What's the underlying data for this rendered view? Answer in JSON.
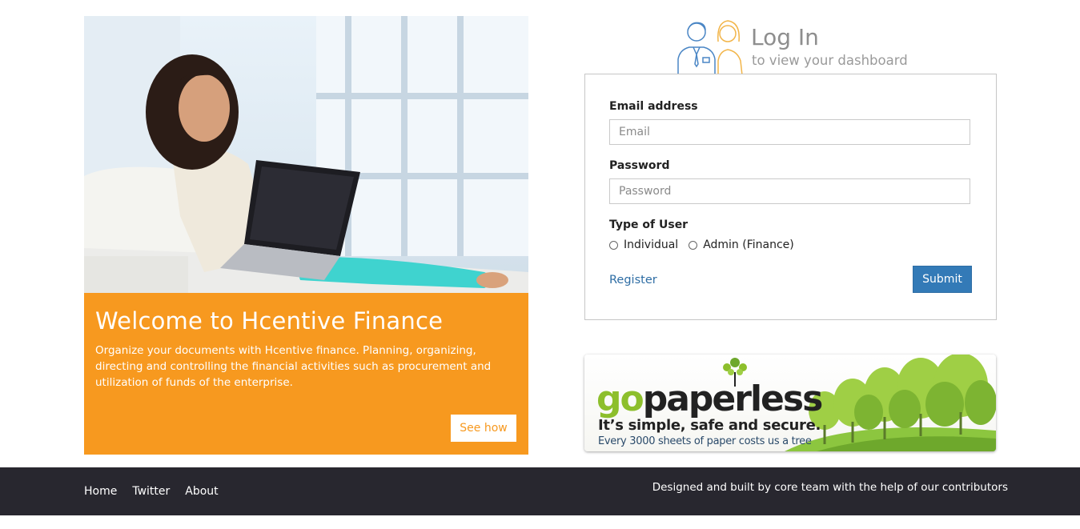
{
  "hero": {
    "title": "Welcome to Hcentive Finance",
    "description": "Organize your documents with Hcentive finance. Planning, organizing, directing and controlling the financial activities such as procurement and utilization of funds of the enterprise.",
    "see_how_label": "See how",
    "accent_color": "#f7991f"
  },
  "login": {
    "title": "Log In",
    "subtitle": "to view your dashboard",
    "email_label": "Email address",
    "email_placeholder": "Email",
    "email_value": "",
    "password_label": "Password",
    "password_placeholder": "Password",
    "password_value": "",
    "user_type_label": "Type of User",
    "user_types": [
      "Individual",
      "Admin (Finance)"
    ],
    "register_label": "Register",
    "submit_label": "Submit",
    "submit_color": "#337ab7",
    "link_color": "#2e6da4",
    "icons": [
      "male-user-icon",
      "female-user-icon"
    ]
  },
  "banner": {
    "logo_go": "go",
    "logo_rest": "paperless",
    "tagline": "It’s simple, safe and secure.",
    "note": "Every 3000 sheets of paper costs us a tree",
    "brand_green": "#8dbf2c"
  },
  "footer": {
    "links": [
      "Home",
      "Twitter",
      "About"
    ],
    "credit": "Designed and built by core team with the help of our contributors",
    "background": "#28272f"
  }
}
